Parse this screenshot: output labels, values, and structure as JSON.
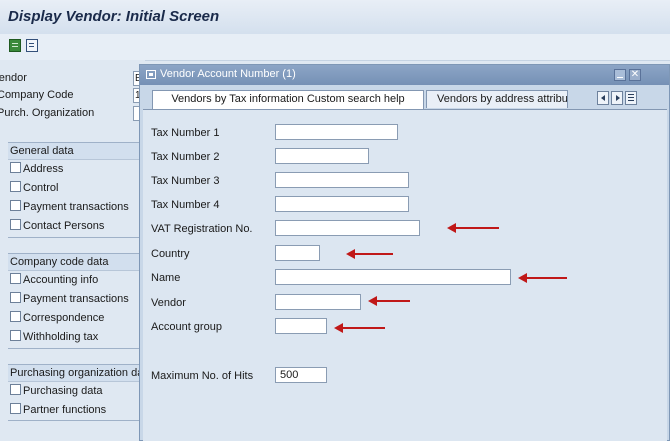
{
  "window": {
    "title": "Display Vendor:  Initial Screen"
  },
  "toolbar": {
    "icons": [
      "create-icon",
      "list-icon"
    ]
  },
  "left_fields": [
    {
      "label": "Vendor",
      "value": "E"
    },
    {
      "label": "Company Code",
      "value": "1"
    },
    {
      "label": "Purch. Organization",
      "value": ""
    }
  ],
  "sections": [
    {
      "header": "General data",
      "items": [
        "Address",
        "Control",
        "Payment transactions",
        "Contact Persons"
      ]
    },
    {
      "header": "Company code data",
      "items": [
        "Accounting info",
        "Payment transactions",
        "Correspondence",
        "Withholding tax"
      ]
    },
    {
      "header": "Purchasing organization data",
      "items": [
        "Purchasing data",
        "Partner functions"
      ]
    }
  ],
  "dialog": {
    "title": "Vendor Account Number (1)",
    "tabs": [
      {
        "label": "Vendors by Tax information Custom search help",
        "active": true
      },
      {
        "label": "Vendors by address attribu...",
        "active": false
      }
    ],
    "fields": [
      {
        "label": "Tax Number 1",
        "value": ""
      },
      {
        "label": "Tax Number 2",
        "value": ""
      },
      {
        "label": "Tax Number 3",
        "value": ""
      },
      {
        "label": "Tax Number 4",
        "value": ""
      },
      {
        "label": "VAT Registration No.",
        "value": ""
      },
      {
        "label": "Country",
        "value": ""
      },
      {
        "label": "Name",
        "value": ""
      },
      {
        "label": "Vendor",
        "value": ""
      },
      {
        "label": "Account group",
        "value": ""
      }
    ],
    "max_hits": {
      "label": "Maximum No. of Hits",
      "value": "500"
    }
  },
  "annotation": {
    "arrow_color": "#c01818"
  }
}
